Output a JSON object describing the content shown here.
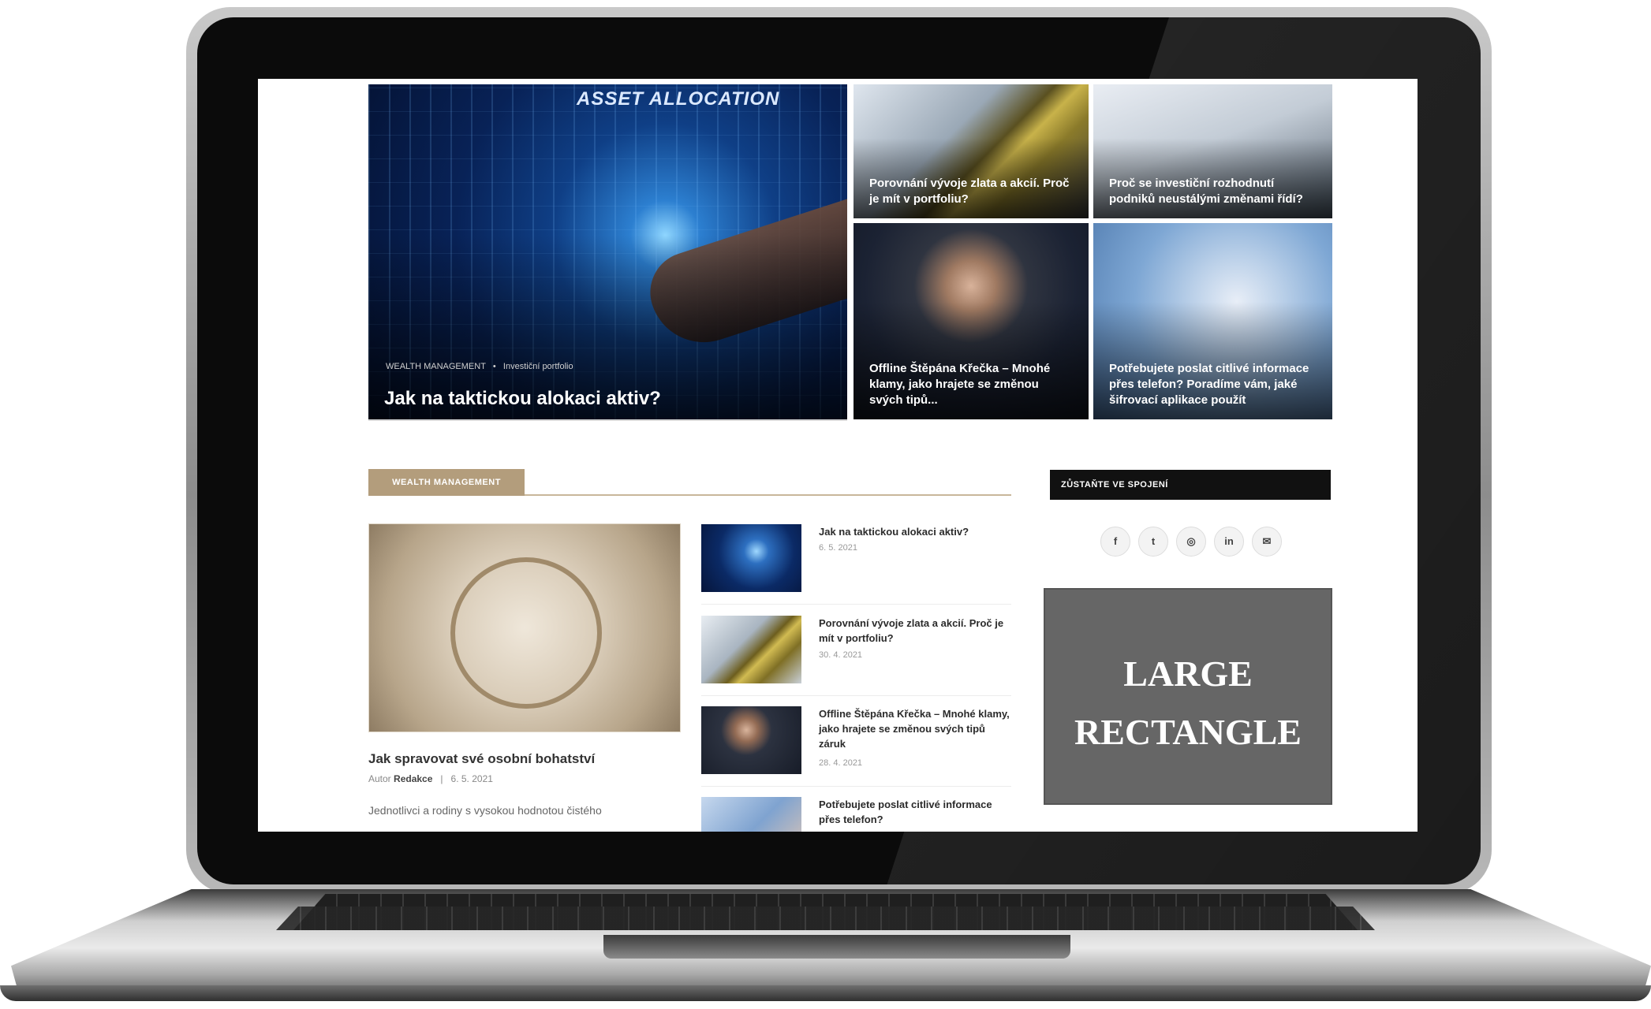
{
  "hero": {
    "image_text": "ASSET ALLOCATION",
    "breadcrumbs": [
      "WEALTH MANAGEMENT",
      "Investiční portfolio"
    ],
    "breadcrumb_sep": "•",
    "title": "Jak na taktickou alokaci aktiv?"
  },
  "tiles": [
    {
      "title": "Porovnání vývoje zlata a akcií. Proč je mít v portfoliu?"
    },
    {
      "title": "Proč se investiční rozhodnutí podniků neustálými změnami řídí?"
    },
    {
      "title": "Offline Štěpána Křečka – Mnohé klamy, jako hrajete se změnou svých tipů..."
    },
    {
      "title": "Potřebujete poslat citlivé informace přes telefon? Poradíme vám, jaké šifrovací aplikace použít"
    }
  ],
  "section": {
    "label": "WEALTH MANAGEMENT"
  },
  "featured": {
    "title": "Jak spravovat své osobní bohatství",
    "author_prefix": "Autor",
    "author": "Redakce",
    "date": "6. 5. 2021",
    "excerpt": "Jednotlivci a rodiny s vysokou hodnotou čistého"
  },
  "list": [
    {
      "title": "Jak na taktickou alokaci aktiv?",
      "date": "6. 5. 2021"
    },
    {
      "title": "Porovnání vývoje zlata a akcií. Proč je mít v portfoliu?",
      "date": "30. 4. 2021"
    },
    {
      "title": "Offline Štěpána Křečka – Mnohé klamy, jako hrajete se změnou svých tipů záruk",
      "date": "28. 4. 2021"
    },
    {
      "title": "Potřebujete poslat citlivé informace přes telefon?",
      "date": ""
    }
  ],
  "sidebar": {
    "heading": "ZŮSTAŇTE VE SPOJENÍ",
    "social": [
      {
        "icon": "facebook-icon",
        "glyph": "f"
      },
      {
        "icon": "twitter-icon",
        "glyph": "t"
      },
      {
        "icon": "instagram-icon",
        "glyph": "◎"
      },
      {
        "icon": "linkedin-icon",
        "glyph": "in"
      },
      {
        "icon": "email-icon",
        "glyph": "✉"
      }
    ],
    "ad_line1": "LARGE",
    "ad_line2": "RECTANGLE"
  },
  "colors": {
    "accent": "#b39d7c",
    "dark": "#111111",
    "ad_bg": "#666666"
  }
}
